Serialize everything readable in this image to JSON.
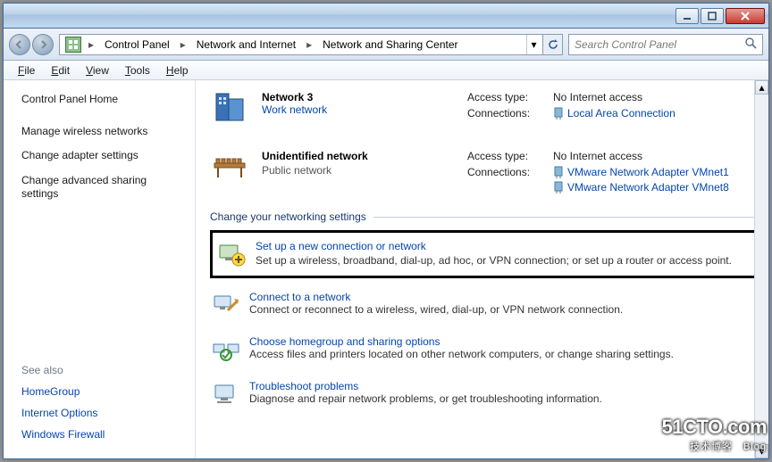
{
  "titlebar": {},
  "breadcrumb": {
    "item0": "Control Panel",
    "item1": "Network and Internet",
    "item2": "Network and Sharing Center"
  },
  "search": {
    "placeholder": "Search Control Panel"
  },
  "menu": {
    "file": "File",
    "edit": "Edit",
    "view": "View",
    "tools": "Tools",
    "help": "Help"
  },
  "sidebar": {
    "home": "Control Panel Home",
    "link0": "Manage wireless networks",
    "link1": "Change adapter settings",
    "link2": "Change advanced sharing settings",
    "seealso": "See also",
    "blue0": "HomeGroup",
    "blue1": "Internet Options",
    "blue2": "Windows Firewall"
  },
  "networks": {
    "n0": {
      "title": "Network  3",
      "sub": "Work network",
      "access_label": "Access type:",
      "access_val": "No Internet access",
      "conn_label": "Connections:",
      "conn_val": "Local Area Connection"
    },
    "n1": {
      "title": "Unidentified network",
      "sub": "Public network",
      "access_label": "Access type:",
      "access_val": "No Internet access",
      "conn_label": "Connections:",
      "conn_val0": "VMware Network Adapter VMnet1",
      "conn_val1": "VMware Network Adapter VMnet8"
    }
  },
  "section": {
    "title": "Change your networking settings"
  },
  "tasks": {
    "t0": {
      "title": "Set up a new connection or network",
      "desc": "Set up a wireless, broadband, dial-up, ad hoc, or VPN connection; or set up a router or access point."
    },
    "t1": {
      "title": "Connect to a network",
      "desc": "Connect or reconnect to a wireless, wired, dial-up, or VPN network connection."
    },
    "t2": {
      "title": "Choose homegroup and sharing options",
      "desc": "Access files and printers located on other network computers, or change sharing settings."
    },
    "t3": {
      "title": "Troubleshoot problems",
      "desc": "Diagnose and repair network problems, or get troubleshooting information."
    }
  },
  "watermark": {
    "big": "51CTO.com",
    "small": "技术博客　Blog"
  }
}
